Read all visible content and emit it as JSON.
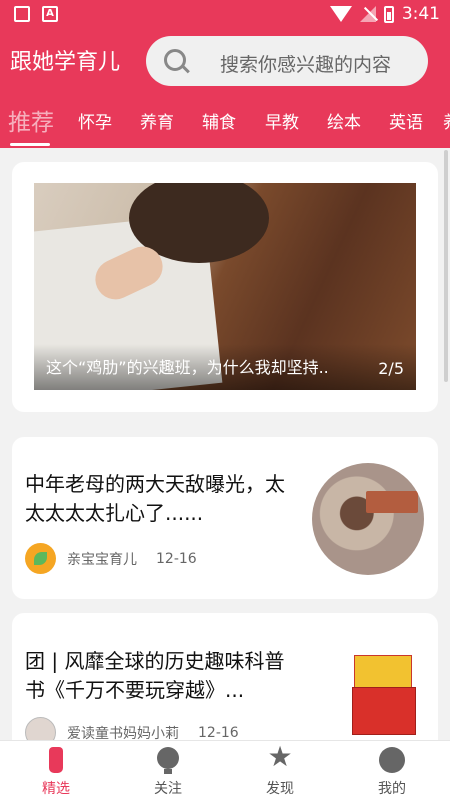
{
  "status": {
    "time": "3:41"
  },
  "header": {
    "app_title": "跟她学育儿",
    "search_placeholder": "搜索你感兴趣的内容"
  },
  "tabs": [
    "推荐",
    "怀孕",
    "养育",
    "辅食",
    "早教",
    "绘本",
    "英语",
    "养"
  ],
  "active_tab": "推荐",
  "banner": {
    "caption": "这个“鸡肋”的兴趣班，为什么我却坚持..",
    "counter": "2/5"
  },
  "articles": [
    {
      "title": "中年老母的两大天敌曝光，太太太太太扎心了......",
      "author": "亲宝宝育儿",
      "date": "12-16"
    },
    {
      "title": "团 | 风靡全球的历史趣味科普书《千万不要玩穿越》...",
      "author": "爱读童书妈妈小莉",
      "date": "12-16"
    }
  ],
  "bottom_nav": [
    {
      "label": "精选",
      "icon": "bottle-icon",
      "active": true
    },
    {
      "label": "关注",
      "icon": "lightbulb-icon",
      "active": false
    },
    {
      "label": "发现",
      "icon": "star-icon",
      "active": false
    },
    {
      "label": "我的",
      "icon": "face-icon",
      "active": false
    }
  ],
  "colors": {
    "brand": "#e8395a",
    "background": "#f2f2f2"
  }
}
